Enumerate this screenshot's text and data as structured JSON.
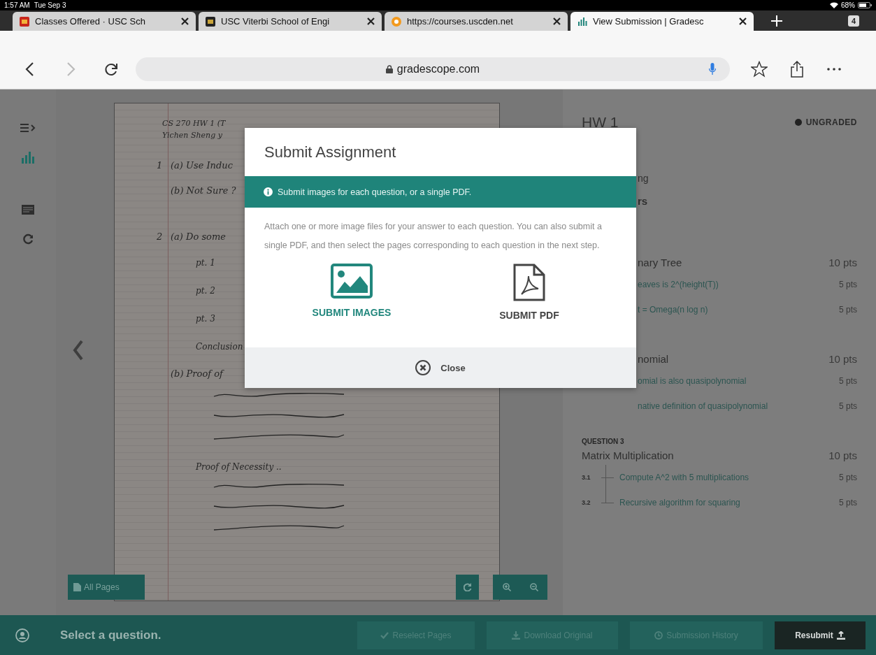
{
  "status_bar": {
    "time": "1:57 AM",
    "date": "Tue Sep 3",
    "battery": "68%"
  },
  "tabs": [
    {
      "title": "Classes Offered · USC Sch",
      "kind": "red-square",
      "selected": false
    },
    {
      "title": "USC Viterbi School of Engi",
      "kind": "dark-square",
      "selected": false
    },
    {
      "title": "https://courses.uscden.net",
      "kind": "orange-circle",
      "selected": false
    },
    {
      "title": "View Submission | Gradesc",
      "kind": "bars",
      "selected": true
    }
  ],
  "tab_count": "4",
  "address_bar": {
    "url": "gradescope.com"
  },
  "sidebar": {
    "items": [
      {
        "kind": "menu",
        "selected": false
      },
      {
        "kind": "chart",
        "selected": true
      },
      {
        "kind": "list",
        "selected": false
      },
      {
        "kind": "reload",
        "selected": false
      }
    ]
  },
  "document": {
    "notes": [
      {
        "kind": "title",
        "text": "CS 270 HW 1 (T"
      },
      {
        "kind": "title",
        "text": "Yichen Sheng y"
      },
      {
        "kind": "question",
        "number": "1",
        "text": "(a) Use Induc"
      },
      {
        "kind": "part",
        "text": "(b) Not Sure ?"
      },
      {
        "kind": "question",
        "number": "2",
        "text": "(a) Do some"
      },
      {
        "kind": "point",
        "text": "pt. 1"
      },
      {
        "kind": "point",
        "text": "pt. 2"
      },
      {
        "kind": "point",
        "text": "pt. 3"
      },
      {
        "kind": "point",
        "text": "Conclusion"
      },
      {
        "kind": "part",
        "text": "(b) Proof of"
      },
      {
        "kind": "scribble"
      },
      {
        "kind": "scribble"
      },
      {
        "kind": "scribble"
      },
      {
        "kind": "point",
        "text": "Proof of Necessity .."
      },
      {
        "kind": "scribble"
      },
      {
        "kind": "scribble"
      },
      {
        "kind": "scribble"
      }
    ]
  },
  "viewer_tools": {
    "all_pages": "All Pages"
  },
  "panel": {
    "title": "HW 1",
    "status": "UNGRADED",
    "details": [
      "ng",
      "rs"
    ],
    "questions": [
      {
        "covered": true,
        "title": "nary Tree",
        "points": "10 pts",
        "parts": [
          {
            "text": "eaves is 2^(height(T))",
            "points": "5 pts"
          },
          {
            "text": "t = Omega(n log n)",
            "points": "5 pts"
          }
        ]
      },
      {
        "covered": true,
        "title": "nomial",
        "points": "10 pts",
        "parts": [
          {
            "text": "omial is also quasipolynomial",
            "points": "5 pts"
          },
          {
            "text": "native definition of quasipolynomial",
            "points": "5 pts"
          }
        ]
      },
      {
        "covered": false,
        "label": "QUESTION 3",
        "title": "Matrix Multiplication",
        "points": "10 pts",
        "parts": [
          {
            "number": "3.1",
            "text": "Compute A^2 with 5 multiplications",
            "points": "5 pts"
          },
          {
            "number": "3.2",
            "text": "Recursive algorithm for squaring",
            "points": "5 pts"
          }
        ]
      }
    ]
  },
  "dialog": {
    "title": "Submit Assignment",
    "notice": "Submit images for each question, or a single PDF.",
    "description": "Attach one or more image files for your answer to each question. You can also submit a single PDF, and then select the pages corresponding to each question in the next step.",
    "options": [
      {
        "kind": "images",
        "label": "SUBMIT IMAGES"
      },
      {
        "kind": "pdf",
        "label": "SUBMIT PDF"
      }
    ],
    "close": "Close"
  },
  "footer": {
    "prompt": "Select a question.",
    "actions": [
      {
        "kind": "check",
        "label": "Reselect Pages",
        "disabled": true
      },
      {
        "kind": "download",
        "label": "Download Original",
        "disabled": true
      },
      {
        "kind": "history",
        "label": "Submission History",
        "disabled": true
      },
      {
        "kind": "upload",
        "label": "Resubmit",
        "disabled": false
      }
    ]
  }
}
